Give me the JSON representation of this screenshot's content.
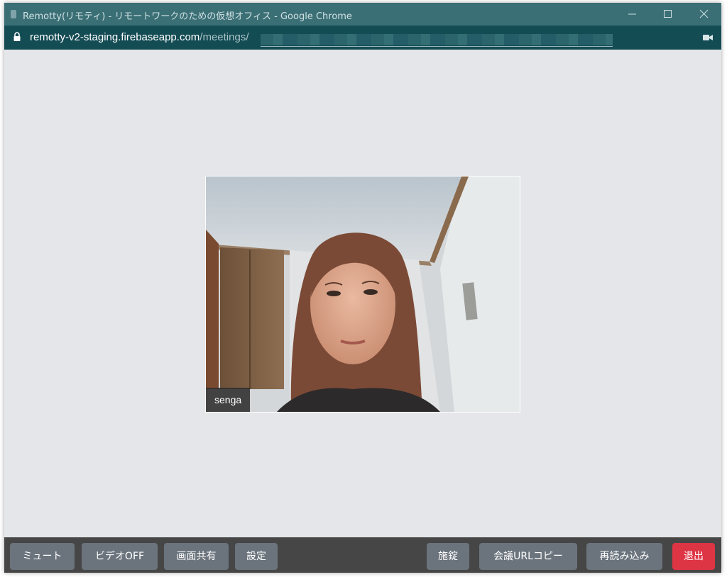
{
  "window": {
    "title": "Remotty(リモティ) - リモートワークのための仮想オフィス - Google Chrome"
  },
  "address_bar": {
    "host": "remotty-v2-staging.firebaseapp.com",
    "path": "/meetings/"
  },
  "participants": [
    {
      "name": "senga"
    }
  ],
  "toolbar": {
    "left_buttons": [
      "ミュート",
      "ビデオOFF",
      "画面共有",
      "設定"
    ],
    "right_buttons": [
      "施錠",
      "会議URLコピー",
      "再読み込み",
      "退出"
    ]
  },
  "colors": {
    "titlebar": "#3b6f76",
    "addressbar": "#144c54",
    "content_bg": "#e4e6e9",
    "toolbar_bg": "#464646",
    "button": "#6b747d",
    "exit_button": "#de3545"
  }
}
